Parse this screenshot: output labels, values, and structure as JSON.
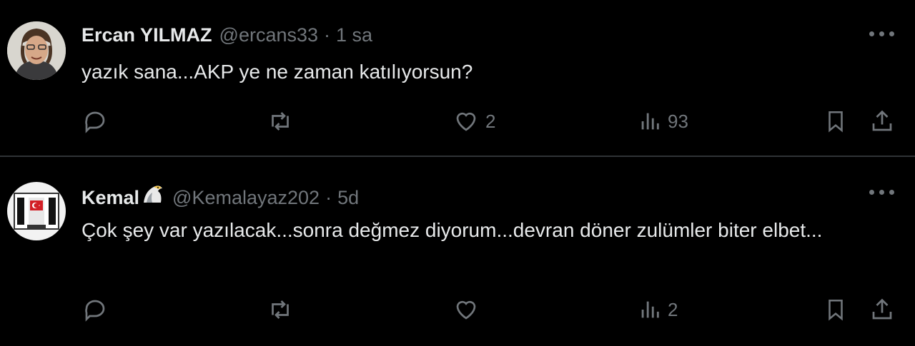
{
  "tweets": [
    {
      "name": "Ercan YILMAZ",
      "handle": "@ercans33",
      "separator": "·",
      "time": "1 sa",
      "text": "yazık sana...AKP ye ne zaman katılıyorsun?",
      "badge": null,
      "avatar": "person-photo",
      "likes": "2",
      "views": "93"
    },
    {
      "name": "Kemal",
      "handle": "@Kemalayaz202",
      "separator": "·",
      "time": "5d",
      "text": "Çok şey var yazılacak...sonra değmez diyorum...devran döner zulümler biter elbet...",
      "badge": "eagle-icon",
      "avatar": "besiktas-crest",
      "likes": "",
      "views": "2"
    }
  ],
  "icons": [
    "reply-icon",
    "retweet-icon",
    "heart-icon",
    "views-icon",
    "bookmark-icon",
    "share-icon",
    "more-icon"
  ],
  "colors": {
    "background": "#000000",
    "text": "#e7e9ea",
    "muted": "#71767b",
    "divider": "#2f3336"
  }
}
